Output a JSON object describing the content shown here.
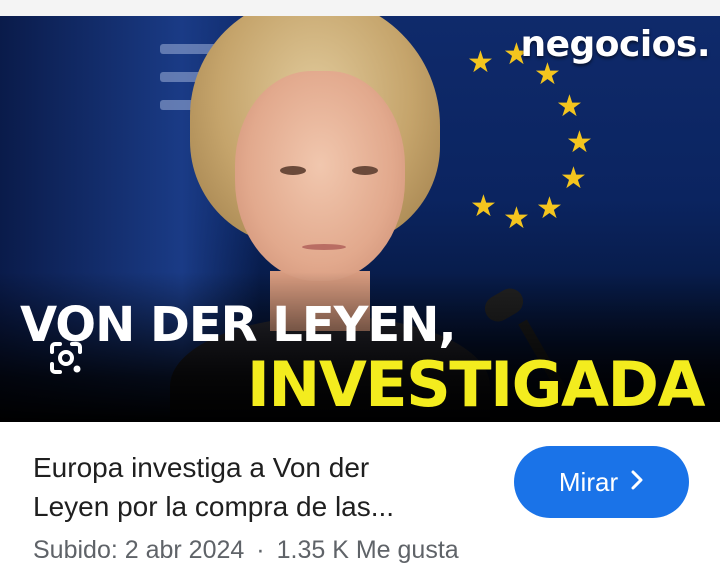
{
  "thumbnail": {
    "brand": "negocios.",
    "headline_line1": "VON DER LEYEN,",
    "headline_line2": "INVESTIGADA",
    "lens_icon": "image-search-icon"
  },
  "result": {
    "title_line1": "Europa investiga a Von der",
    "title_line2": "Leyen por la compra de las...",
    "watch_label": "Mirar",
    "watch_icon": "chevron-right-icon",
    "uploaded": "Subido: 2 abr 2024",
    "separator": "·",
    "likes": "1.35 K Me gusta"
  },
  "colors": {
    "accent_button": "#1a73e8",
    "headline_yellow": "#f3ec1e",
    "eu_star": "#f4c51e",
    "title_text": "#1f1f1f",
    "meta_text": "#5f6368"
  }
}
